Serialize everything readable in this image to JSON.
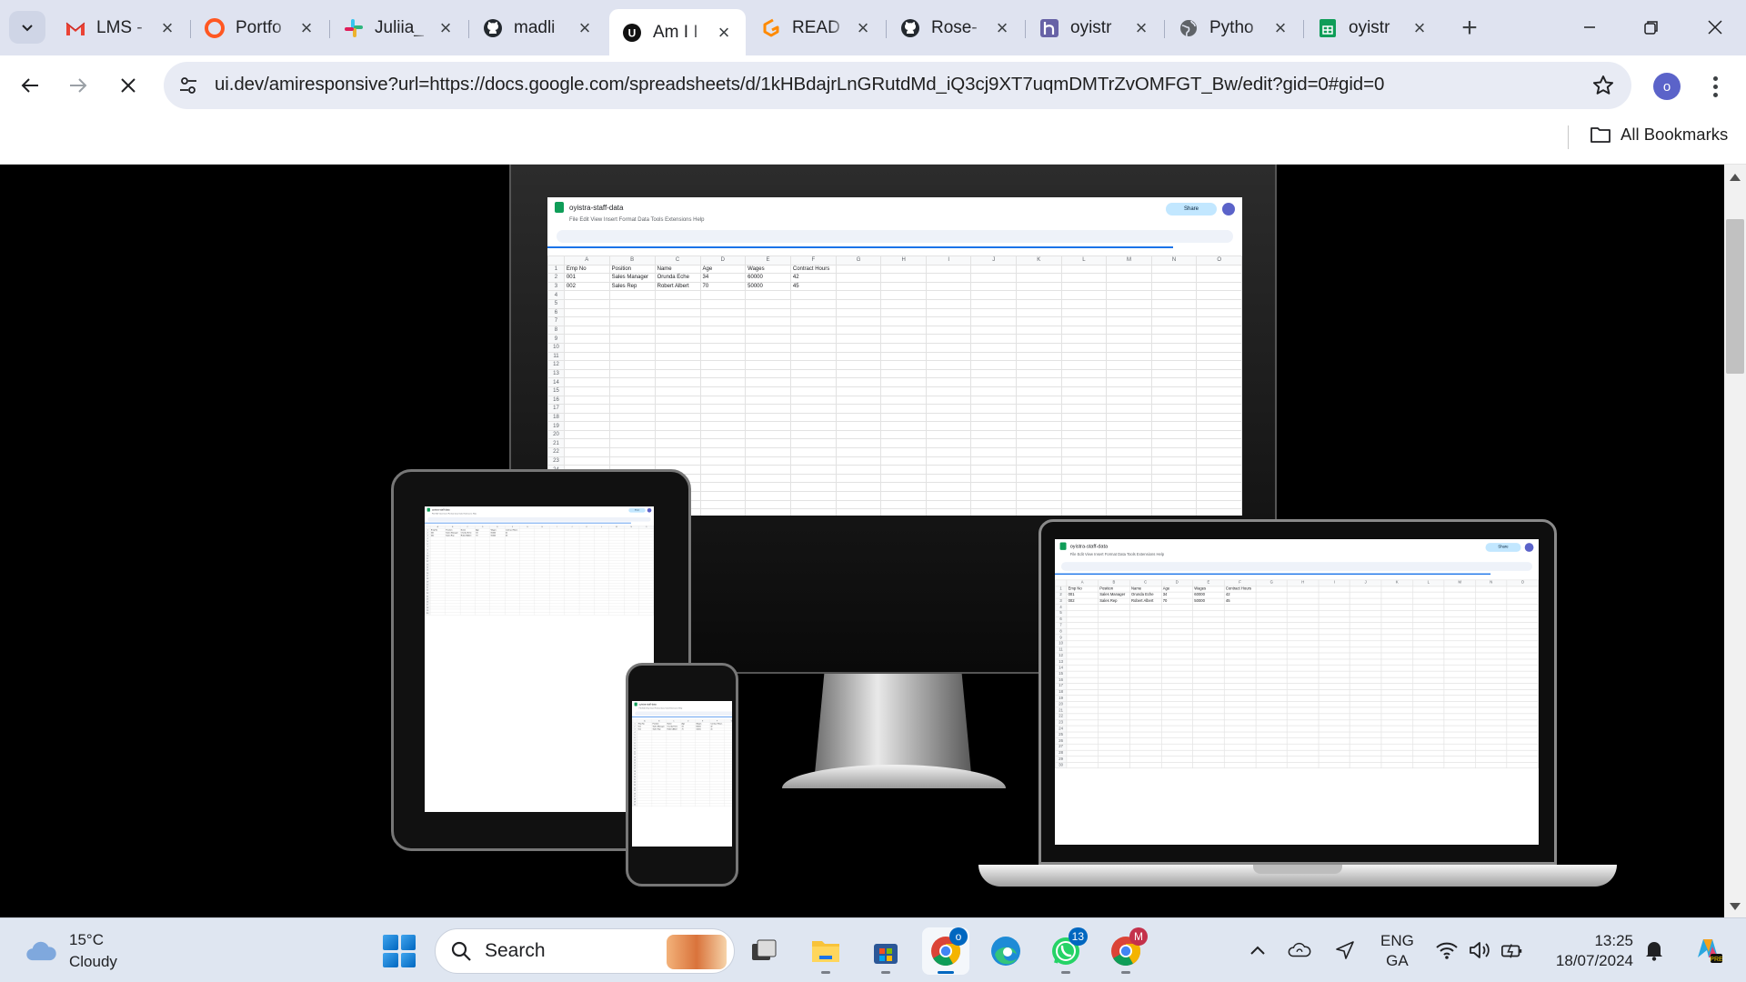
{
  "browser": {
    "tabs": [
      {
        "title": "LMS -",
        "icon": "gmail-icon",
        "color": "#ea4335"
      },
      {
        "title": "Portfo",
        "icon": "portfolio-icon",
        "color": "#ff5722"
      },
      {
        "title": "Juliia_",
        "icon": "slack-icon",
        "color": "#e01e5a"
      },
      {
        "title": "madli",
        "icon": "github-icon",
        "color": "#24292f"
      },
      {
        "title": "Am I I",
        "icon": "amiresponsive-icon",
        "color": "#111111",
        "active": true
      },
      {
        "title": "READ",
        "icon": "gitpod-icon",
        "color": "#ff8a00"
      },
      {
        "title": "Rose-",
        "icon": "github-icon",
        "color": "#24292f"
      },
      {
        "title": "oyistr",
        "icon": "heroku-icon",
        "color": "#6762a6"
      },
      {
        "title": "Pytho",
        "icon": "globe-icon",
        "color": "#5f6368"
      },
      {
        "title": "oyistr",
        "icon": "sheets-icon",
        "color": "#0f9d58"
      }
    ],
    "url": "ui.dev/amiresponsive?url=https://docs.google.com/spreadsheets/d/1kHBdajrLnGRutdMd_iQ3cj9XT7uqmDMTrZvOMFGT_Bw/edit?gid=0#gid=0",
    "profile_initial": "o",
    "bookmarks_label": "All Bookmarks"
  },
  "sheet": {
    "title": "oyistra-staff-data",
    "menu": "File   Edit   View   Insert   Format   Data   Tools   Extensions   Help",
    "share": "Share",
    "columns": [
      "A",
      "B",
      "C",
      "D",
      "E",
      "F",
      "G",
      "H",
      "I",
      "J",
      "K",
      "L",
      "M",
      "N",
      "O"
    ],
    "header": [
      "Emp No",
      "Position",
      "Name",
      "Age",
      "Wages",
      "Contract Hours"
    ],
    "rows": [
      [
        "001",
        "Sales Manager",
        "Orunda Eche",
        "34",
        "60000",
        "42"
      ],
      [
        "002",
        "Sales Rep",
        "Robert Albert",
        "70",
        "50000",
        "45"
      ]
    ]
  },
  "taskbar": {
    "weather_temp": "15°C",
    "weather_desc": "Cloudy",
    "search_label": "Search",
    "chrome_badge": "o",
    "whatsapp_badge": "13",
    "chrome2_badge": "M",
    "lang_top": "ENG",
    "lang_bottom": "GA",
    "time": "13:25",
    "date": "18/07/2024"
  }
}
